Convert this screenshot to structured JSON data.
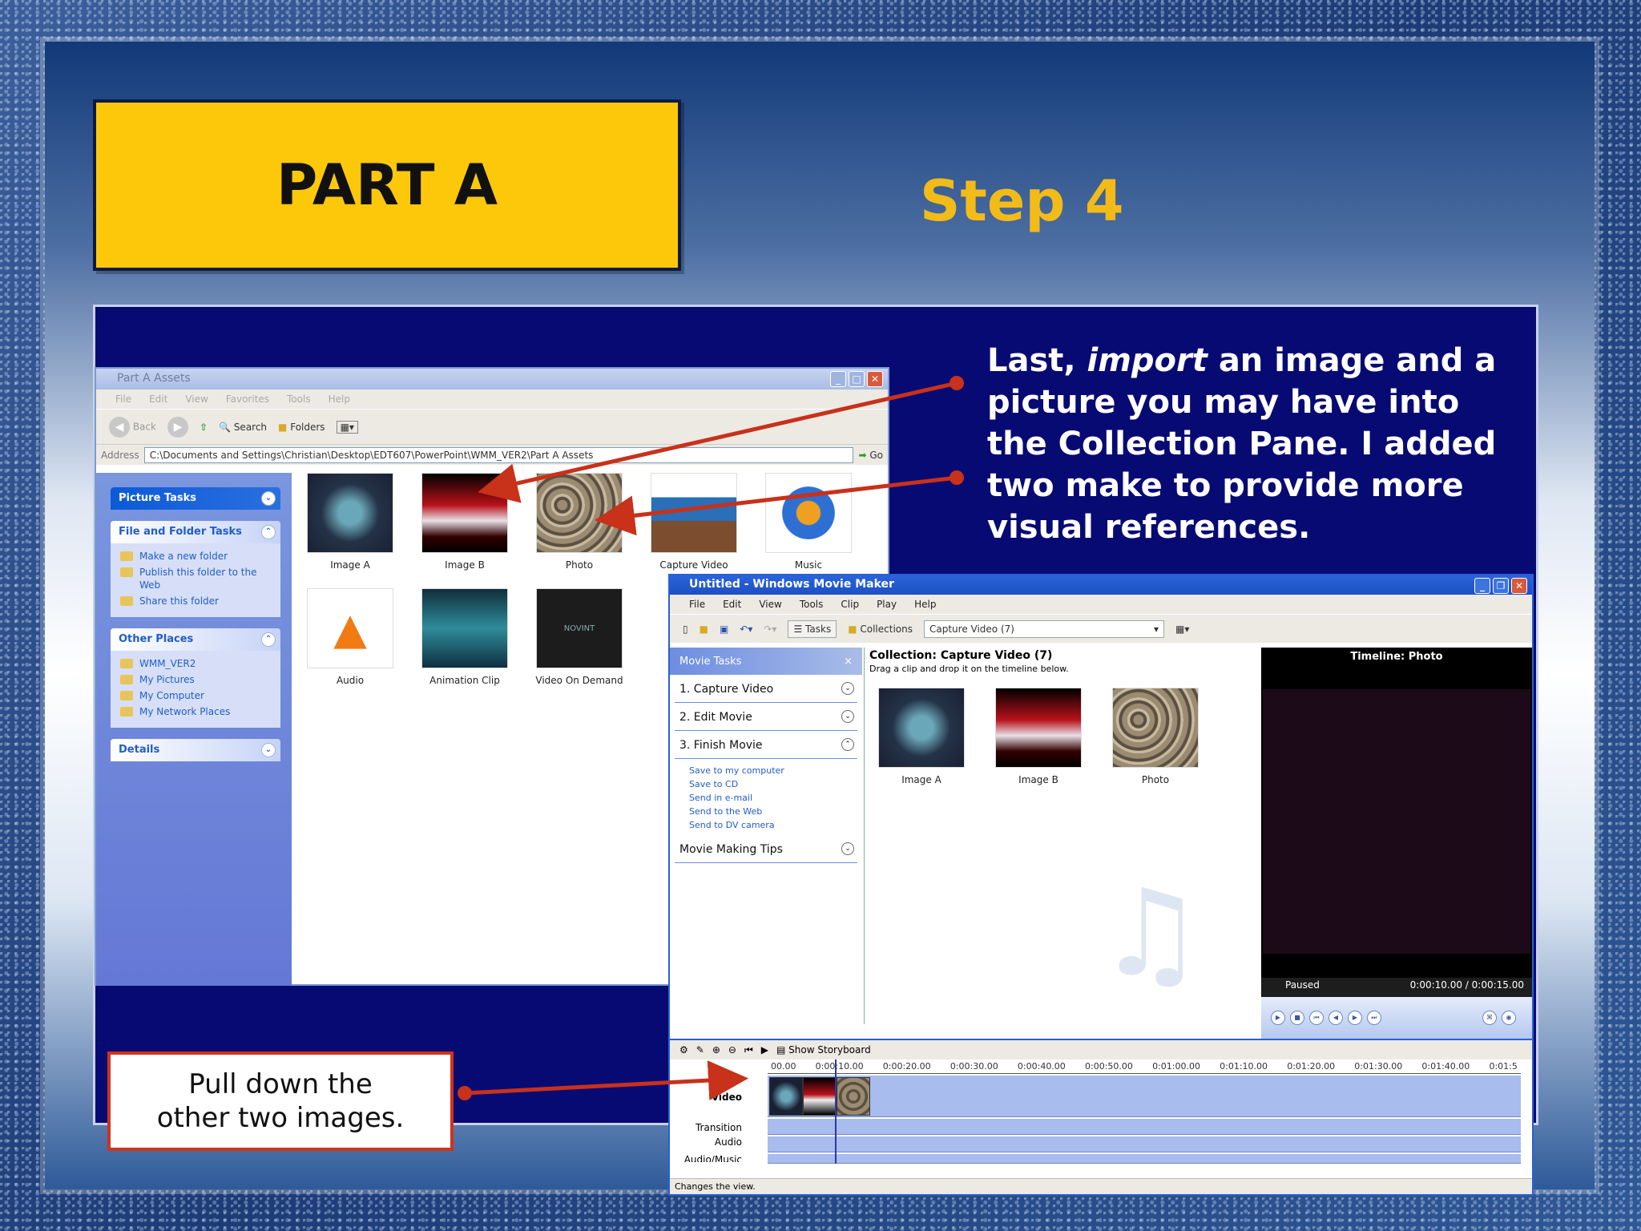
{
  "slide": {
    "badge": "PART A",
    "step": "Step 4",
    "instruction_parts": [
      "Last, ",
      "import",
      " an image and a picture you may have into the  Collection Pane.  I added two make to provide more visual references."
    ],
    "note": [
      "Pull down the",
      "other two images."
    ]
  },
  "explorer": {
    "title": "Part A Assets",
    "menu": [
      "File",
      "Edit",
      "View",
      "Favorites",
      "Tools",
      "Help"
    ],
    "toolbar": {
      "back": "Back",
      "search": "Search",
      "folders": "Folders"
    },
    "address_label": "Address",
    "address": "C:\\Documents and Settings\\Christian\\Desktop\\EDT607\\PowerPoint\\WMM_VER2\\Part A Assets",
    "go": "Go",
    "picture_tasks": "Picture Tasks",
    "file_tasks": {
      "title": "File and Folder Tasks",
      "items": [
        "Make a new folder",
        "Publish this folder to the Web",
        "Share this folder"
      ]
    },
    "other_places": {
      "title": "Other Places",
      "items": [
        "WMM_VER2",
        "My Pictures",
        "My Computer",
        "My Network Places"
      ]
    },
    "details": "Details",
    "files": [
      "Image A",
      "Image B",
      "Photo",
      "Capture Video",
      "Music",
      "Audio",
      "Animation Clip",
      "Video On Demand"
    ],
    "novint": "NOVINT"
  },
  "moviemaker": {
    "title": "Untitled - Windows Movie Maker",
    "menu": [
      "File",
      "Edit",
      "View",
      "Tools",
      "Clip",
      "Play",
      "Help"
    ],
    "toolbar": {
      "tasks": "Tasks",
      "collections": "Collections",
      "collection_select": "Capture Video (7)"
    },
    "tasks_header": "Movie Tasks",
    "tasks": [
      "1. Capture Video",
      "2. Edit Movie",
      "3. Finish Movie"
    ],
    "finish_items": [
      "Save to my computer",
      "Save to CD",
      "Send in e-mail",
      "Send to the Web",
      "Send to DV camera"
    ],
    "tips": "Movie Making Tips",
    "collection_title": "Collection: Capture Video (7)",
    "collection_hint": "Drag a clip and drop it on the timeline below.",
    "collection_items": [
      "Image A",
      "Image B",
      "Photo"
    ],
    "monitor": {
      "title": "Timeline: Photo",
      "status": "Paused",
      "time": "0:00:10.00 / 0:00:15.00"
    },
    "timeline": {
      "show_storyboard": "Show Storyboard",
      "ticks": [
        "00.00",
        "0:00:10.00",
        "0:00:20.00",
        "0:00:30.00",
        "0:00:40.00",
        "0:00:50.00",
        "0:01:00.00",
        "0:01:10.00",
        "0:01:20.00",
        "0:01:30.00",
        "0:01:40.00",
        "0:01:5"
      ],
      "tracks": [
        "Video",
        "Transition",
        "Audio",
        "Audio/Music"
      ]
    },
    "status": "Changes the view."
  },
  "colors": {
    "badge": "#fec80a",
    "step": "#f2bb18",
    "panel": "#080a73",
    "arrow": "#c8311a",
    "xp_blue": "#2a5fd6"
  }
}
